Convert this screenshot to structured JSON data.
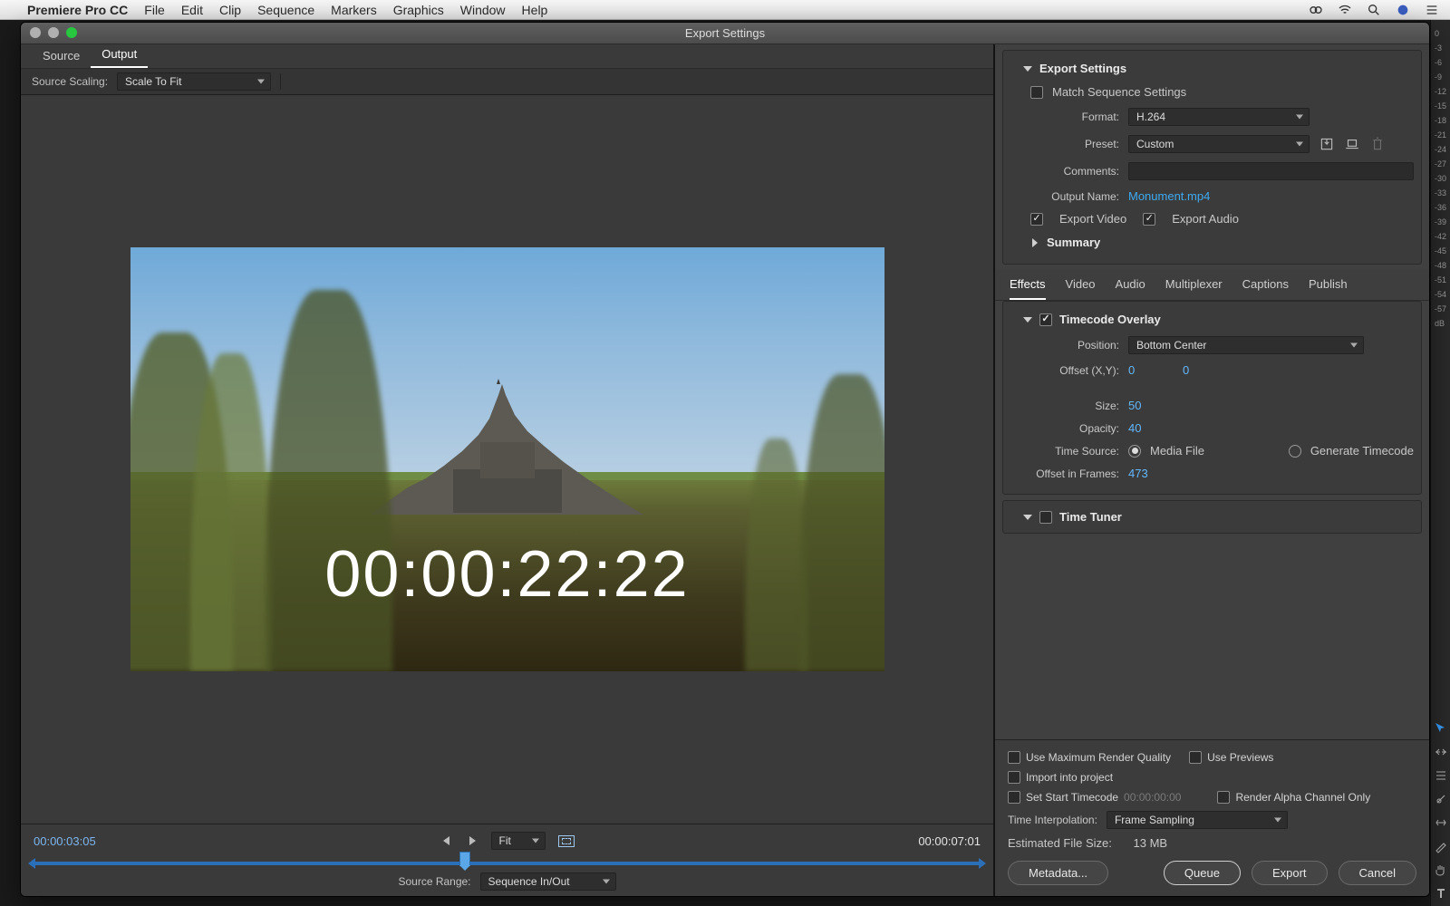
{
  "menubar": {
    "app": "Premiere Pro CC",
    "items": [
      "File",
      "Edit",
      "Clip",
      "Sequence",
      "Markers",
      "Graphics",
      "Window",
      "Help"
    ]
  },
  "window": {
    "title": "Export Settings"
  },
  "preview": {
    "tabs": {
      "source": "Source",
      "output": "Output",
      "active": "Output"
    },
    "source_scaling_label": "Source Scaling:",
    "source_scaling_value": "Scale To Fit",
    "timecode_overlay": "00:00:22:22",
    "tc_left": "00:00:03:05",
    "tc_right": "00:00:07:01",
    "fit_label": "Fit",
    "source_range_label": "Source Range:",
    "source_range_value": "Sequence In/Out"
  },
  "export": {
    "section": "Export Settings",
    "match_seq": "Match Sequence Settings",
    "format_label": "Format:",
    "format_value": "H.264",
    "preset_label": "Preset:",
    "preset_value": "Custom",
    "comments_label": "Comments:",
    "output_name_label": "Output Name:",
    "output_name_value": "Monument.mp4",
    "export_video": "Export Video",
    "export_audio": "Export Audio",
    "summary": "Summary"
  },
  "effects_tabs": [
    "Effects",
    "Video",
    "Audio",
    "Multiplexer",
    "Captions",
    "Publish"
  ],
  "timecode_overlay": {
    "title": "Timecode Overlay",
    "position_label": "Position:",
    "position_value": "Bottom Center",
    "offset_label": "Offset (X,Y):",
    "offset_x": "0",
    "offset_y": "0",
    "size_label": "Size:",
    "size_value": "50",
    "opacity_label": "Opacity:",
    "opacity_value": "40",
    "time_source_label": "Time Source:",
    "time_source_media": "Media File",
    "time_source_gen": "Generate Timecode",
    "offset_frames_label": "Offset in Frames:",
    "offset_frames_value": "473"
  },
  "time_tuner": {
    "title": "Time Tuner"
  },
  "bottom": {
    "use_max": "Use Maximum Render Quality",
    "use_previews": "Use Previews",
    "import_project": "Import into project",
    "set_start_tc": "Set Start Timecode",
    "set_start_tc_value": "00:00:00:00",
    "render_alpha": "Render Alpha Channel Only",
    "time_interp_label": "Time Interpolation:",
    "time_interp_value": "Frame Sampling",
    "est_size_label": "Estimated File Size:",
    "est_size_value": "13 MB",
    "metadata": "Metadata...",
    "queue": "Queue",
    "export": "Export",
    "cancel": "Cancel"
  },
  "db_levels": [
    "0",
    "-3",
    "-6",
    "-9",
    "-12",
    "-15",
    "-18",
    "-21",
    "-24",
    "-27",
    "-30",
    "-33",
    "-36",
    "-39",
    "-42",
    "-45",
    "-48",
    "-51",
    "-54",
    "-57",
    "dB"
  ]
}
